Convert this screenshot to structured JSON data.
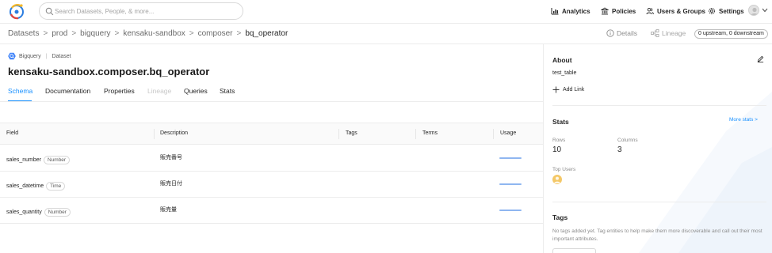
{
  "topbar": {
    "search_placeholder": "Search Datasets, People, & more...",
    "nav": [
      {
        "label": "Analytics",
        "icon": "bar-chart-icon"
      },
      {
        "label": "Policies",
        "icon": "bank-icon"
      },
      {
        "label": "Users & Groups",
        "icon": "users-icon"
      },
      {
        "label": "Settings",
        "icon": "gear-icon"
      }
    ]
  },
  "breadcrumb": {
    "items": [
      "Datasets",
      "prod",
      "bigquery",
      "kensaku-sandbox",
      "composer"
    ],
    "separator": ">",
    "current": "bq_operator"
  },
  "header_actions": {
    "details": "Details",
    "lineage": "Lineage",
    "upstream": "0 upstream, 0 downstream"
  },
  "entity": {
    "platform": "Bigquery",
    "type": "Dataset",
    "title": "kensaku-sandbox.composer.bq_operator",
    "tabs": [
      {
        "label": "Schema",
        "state": "active"
      },
      {
        "label": "Documentation",
        "state": "normal"
      },
      {
        "label": "Properties",
        "state": "normal"
      },
      {
        "label": "Lineage",
        "state": "disabled"
      },
      {
        "label": "Queries",
        "state": "normal"
      },
      {
        "label": "Stats",
        "state": "normal"
      }
    ]
  },
  "schema": {
    "headers": {
      "field": "Field",
      "description": "Description",
      "tags": "Tags",
      "terms": "Terms",
      "usage": "Usage"
    },
    "rows": [
      {
        "field": "sales_number",
        "type": "Number",
        "description": "販売番号",
        "usage": 1.0
      },
      {
        "field": "sales_datetime",
        "type": "Time",
        "description": "販売日付",
        "usage": 1.0
      },
      {
        "field": "sales_quantity",
        "type": "Number",
        "description": "販売量",
        "usage": 1.0
      }
    ]
  },
  "about": {
    "title": "About",
    "description": "test_table",
    "add_link": "Add Link"
  },
  "stats": {
    "title": "Stats",
    "more": "More stats >",
    "rows_label": "Rows",
    "rows_value": "10",
    "columns_label": "Columns",
    "columns_value": "3",
    "top_users_label": "Top Users"
  },
  "tags": {
    "title": "Tags",
    "description": "No tags added yet. Tag entities to help make them more discoverable and call out their most important attributes."
  },
  "colors": {
    "accent": "#1890ff",
    "usage_bar": "#8fb6f0",
    "user_avatar": "#f4c867"
  }
}
